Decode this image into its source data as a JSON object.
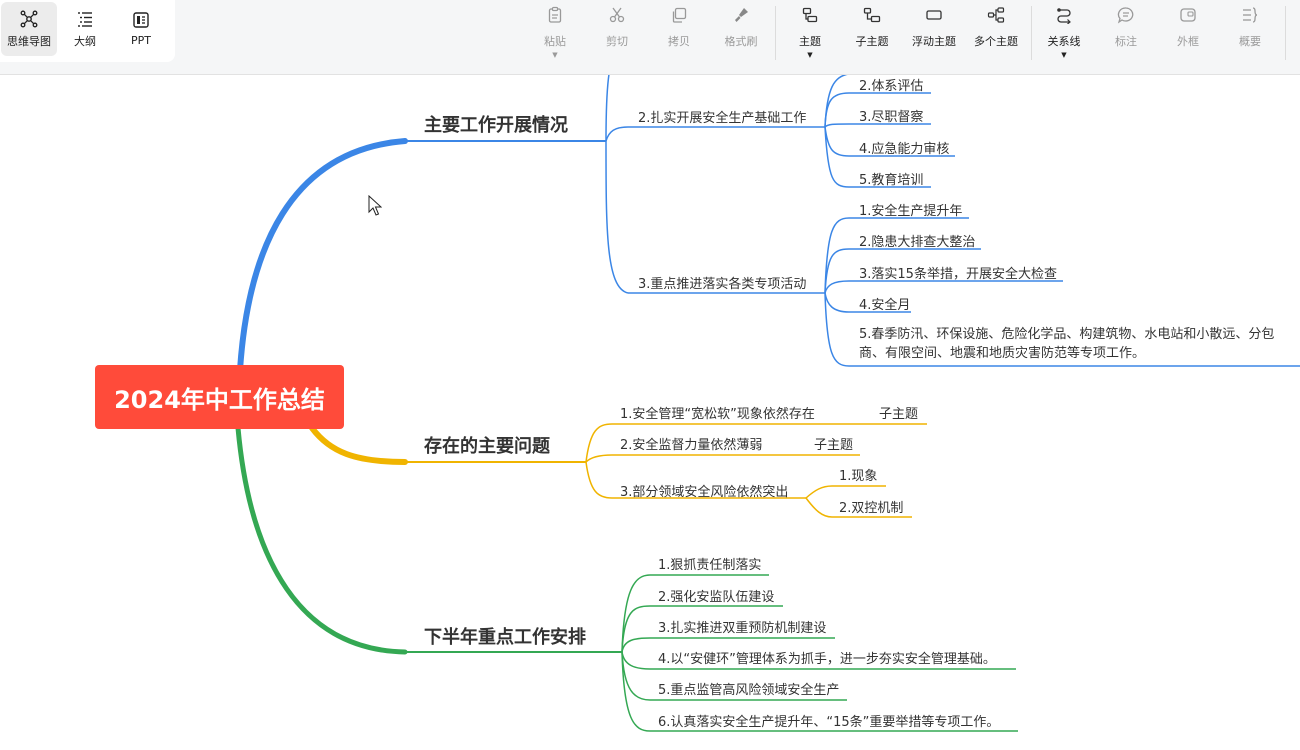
{
  "view_modes": [
    {
      "label": "思维导图",
      "icon": "mindmap-icon",
      "active": true
    },
    {
      "label": "大纲",
      "icon": "outline-icon",
      "active": false
    },
    {
      "label": "PPT",
      "icon": "ppt-icon",
      "active": false
    }
  ],
  "toolbar": {
    "paste": "粘贴",
    "cut": "剪切",
    "copy": "拷贝",
    "format_painter": "格式刷",
    "topic": "主题",
    "subtopic": "子主题",
    "floating_topic": "浮动主题",
    "multi_topic": "多个主题",
    "relation_line": "关系线",
    "label": "标注",
    "frame": "外框",
    "summary": "概要"
  },
  "colors": {
    "root": "#ff4b3a",
    "blue": "#3b86e6",
    "yellow": "#f0b400",
    "green": "#34a853"
  },
  "map": {
    "root": "2024年中工作总结",
    "b1": {
      "title": "主要工作开展情况",
      "s2": {
        "label": "2.扎实开展安全生产基础工作",
        "leaves": [
          "2.体系评估",
          "3.尽职督察",
          "4.应急能力审核",
          "5.教育培训"
        ]
      },
      "s3": {
        "label": "3.重点推进落实各类专项活动",
        "leaves": [
          "1.安全生产提升年",
          "2.隐患大排查大整治",
          "3.落实15条举措，开展安全大检查",
          "4.安全月",
          "5.春季防汛、环保设施、危险化学品、构建筑物、水电站和小散远、分包商、有限空间、地震和地质灾害防范等专项工作。"
        ]
      }
    },
    "b2": {
      "title": "存在的主要问题",
      "items": [
        "1.安全管理“宽松软”现象依然存在",
        "2.安全监督力量依然薄弱",
        "3.部分领域安全风险依然突出"
      ],
      "item1_child": "子主题",
      "item2_child": "子主题",
      "item3_children": [
        "1.现象",
        "2.双控机制"
      ]
    },
    "b3": {
      "title": "下半年重点工作安排",
      "items": [
        "1.狠抓责任制落实",
        "2.强化安监队伍建设",
        "3.扎实推进双重预防机制建设",
        "4.以“安健环”管理体系为抓手，进一步夯实安全管理基础。",
        "5.重点监管高风险领域安全生产",
        "6.认真落实安全生产提升年、“15条”重要举措等专项工作。"
      ]
    }
  }
}
